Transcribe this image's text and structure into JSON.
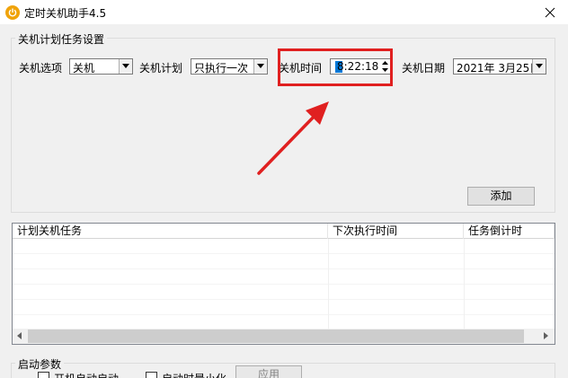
{
  "window": {
    "title": "定时关机助手4.5",
    "icon": "power-icon",
    "accent": "#f0a30a"
  },
  "plan_group": {
    "legend": "关机计划任务设置",
    "option_label": "关机选项",
    "option_value": "关机",
    "plan_label": "关机计划",
    "plan_value": "只执行一次",
    "time_label": "关机时间",
    "time_value": "8:22:18",
    "date_label": "关机日期",
    "date_value": "2021年  3月25日",
    "add_button": "添加"
  },
  "task_list": {
    "columns": [
      "计划关机任务",
      "下次执行时间",
      "任务倒计时"
    ],
    "rows": []
  },
  "startup_group": {
    "legend": "启动参数",
    "check1_label": "开机自动启动",
    "check2_label": "启动时最小化",
    "apply_button": "应用"
  },
  "annotation_color": "#e02020"
}
